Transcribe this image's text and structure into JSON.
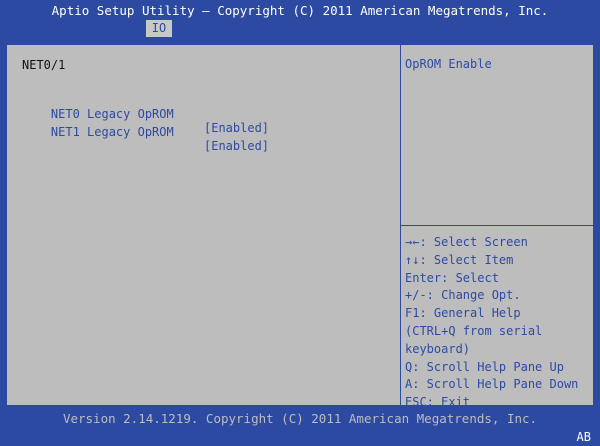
{
  "header": {
    "title": "Aptio Setup Utility – Copyright (C) 2011 American Megatrends, Inc.",
    "tab": "IO"
  },
  "main": {
    "heading": "NET0/1",
    "options": [
      {
        "label": "NET0 Legacy OpROM",
        "value": "[Enabled]"
      },
      {
        "label": "NET1 Legacy OpROM",
        "value": "[Enabled]"
      }
    ]
  },
  "help": {
    "text": "OpROM Enable",
    "keys": [
      "→←: Select Screen",
      "↑↓: Select Item",
      "Enter: Select",
      "+/-: Change Opt.",
      "F1: General Help",
      "(CTRL+Q from serial",
      "keyboard)",
      "Q: Scroll Help Pane Up",
      "A: Scroll Help Pane Down",
      "ESC: Exit"
    ]
  },
  "footer": {
    "version": "Version 2.14.1219. Copyright (C) 2011 American Megatrends, Inc.",
    "badge": "AB"
  },
  "colors": {
    "background": "#2d4aa3",
    "panel": "#bdbdbd",
    "highlight_text": "#2d4aa3"
  }
}
